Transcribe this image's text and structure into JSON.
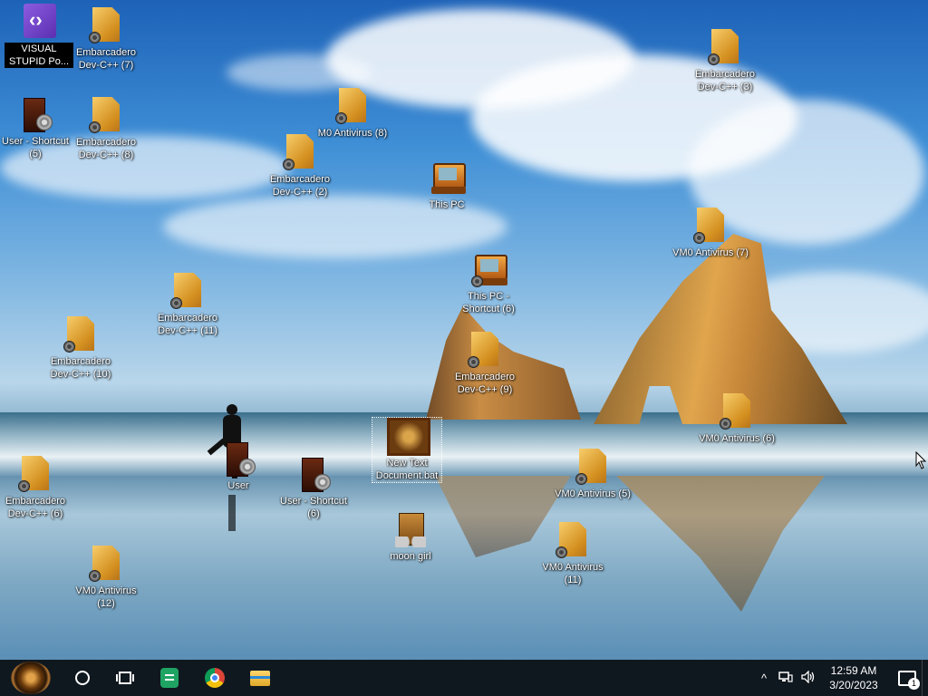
{
  "desktop": {
    "icons": [
      {
        "label": "VISUAL STUPID Po...",
        "icon": "visual-studio-icon",
        "selected": false
      },
      {
        "label": "Embarcadero Dev-C++ (7)",
        "icon": "document-icon"
      },
      {
        "label": "Embarcadero Dev-C++ (3)",
        "icon": "document-icon"
      },
      {
        "label": "User - Shortcut (5)",
        "icon": "user-door-icon"
      },
      {
        "label": "Embarcadero Dev-C++ (8)",
        "icon": "document-icon"
      },
      {
        "label": "M0 Antivirus (8)",
        "icon": "document-icon"
      },
      {
        "label": "Embarcadero Dev-C++ (2)",
        "icon": "document-icon"
      },
      {
        "label": "This PC",
        "icon": "computer-icon"
      },
      {
        "label": "VM0 Antivirus (7)",
        "icon": "document-icon"
      },
      {
        "label": "This PC - Shortcut (6)",
        "icon": "computer-icon"
      },
      {
        "label": "Embarcadero Dev-C++ (11)",
        "icon": "document-icon"
      },
      {
        "label": "Embarcadero Dev-C++ (10)",
        "icon": "document-icon"
      },
      {
        "label": "Embarcadero Dev-C++ (9)",
        "icon": "document-icon"
      },
      {
        "label": "VM0 Antivirus (6)",
        "icon": "document-icon"
      },
      {
        "label": "New Text Document.bat",
        "icon": "picture-frame-icon",
        "selected": true
      },
      {
        "label": "User",
        "icon": "user-door-icon"
      },
      {
        "label": "User - Shortcut (6)",
        "icon": "user-door-icon"
      },
      {
        "label": "Embarcadero Dev-C++ (6)",
        "icon": "document-icon"
      },
      {
        "label": "VM0 Antivirus (5)",
        "icon": "document-icon"
      },
      {
        "label": "moon girl",
        "icon": "box-icon"
      },
      {
        "label": "VM0 Antivirus (11)",
        "icon": "document-icon"
      },
      {
        "label": "VM0 Antivirus (12)",
        "icon": "document-icon"
      }
    ]
  },
  "taskbar": {
    "start_icon": "start-orb-icon",
    "apps": [
      "cortana-icon",
      "task-view-icon",
      "google-sheets-icon",
      "chrome-icon",
      "file-explorer-icon"
    ],
    "tray": {
      "chevron": "^",
      "network": "network-icon",
      "volume": "volume-icon"
    },
    "clock": {
      "time": "12:59 AM",
      "date": "3/20/2023"
    },
    "notifications": {
      "count": "1"
    },
    "colors": {
      "taskbar": "#10181f",
      "accent": "#1fa463"
    }
  }
}
